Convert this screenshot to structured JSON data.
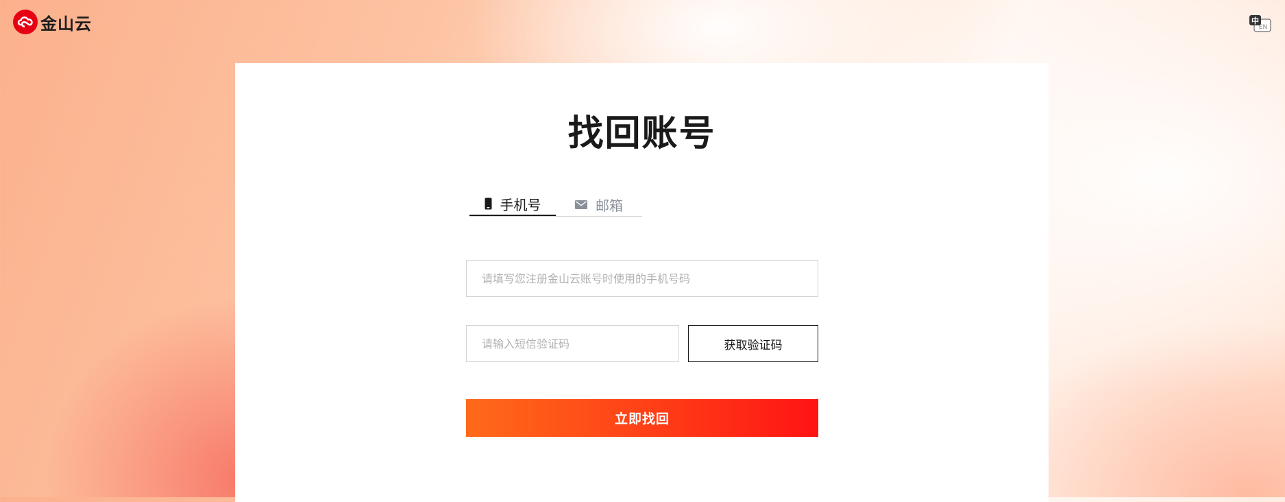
{
  "brand": {
    "name": "金山云",
    "color": "#e60012"
  },
  "header": {
    "lang_icon": "translate-icon",
    "lang_zh": "中",
    "lang_en": "EN"
  },
  "form": {
    "title": "找回账号",
    "tabs": [
      {
        "label": "手机号",
        "icon": "phone-icon",
        "active": true
      },
      {
        "label": "邮箱",
        "icon": "mail-icon",
        "active": false
      }
    ],
    "phone_placeholder": "请填写您注册金山云账号时使用的手机号码",
    "code_placeholder": "请输入短信验证码",
    "get_code_label": "获取验证码",
    "submit_label": "立即找回"
  },
  "colors": {
    "accent_start": "#ff6a1a",
    "accent_end": "#ff1414",
    "text": "#1a1a1a"
  }
}
